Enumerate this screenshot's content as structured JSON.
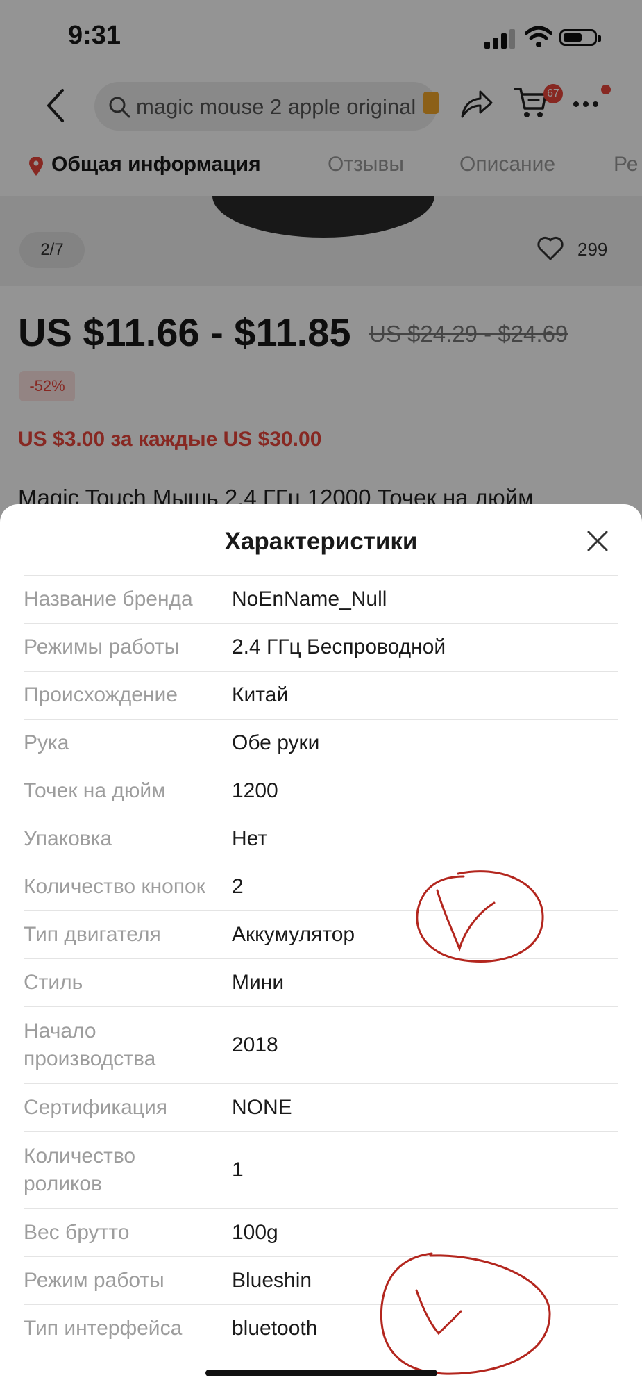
{
  "status_bar": {
    "time": "9:31"
  },
  "search": {
    "query": "magic mouse 2 apple original"
  },
  "cart": {
    "badge": "67"
  },
  "tabs": [
    {
      "label": "Общая информация"
    },
    {
      "label": "Отзывы"
    },
    {
      "label": "Описание"
    },
    {
      "label": "Ре"
    }
  ],
  "gallery": {
    "counter": "2/7",
    "favorites": "299"
  },
  "product": {
    "price": "US $11.66 - $11.85",
    "old_price": "US $24.29 - $24.69",
    "discount": "-52%",
    "promo": "US $3.00 за каждые US $30.00",
    "title": "Magic Touch Мышь 2.4 ГГц 12000 Точек на дюйм"
  },
  "sheet": {
    "title": "Характеристики",
    "rows": [
      {
        "key": "Название бренда",
        "value": "NoEnName_Null"
      },
      {
        "key": "Режимы работы",
        "value": "2.4 ГГц Беспроводной"
      },
      {
        "key": "Происхождение",
        "value": "Китай"
      },
      {
        "key": "Рука",
        "value": "Обе руки"
      },
      {
        "key": "Точек на дюйм",
        "value": "1200"
      },
      {
        "key": "Упаковка",
        "value": "Нет"
      },
      {
        "key": "Количество кнопок",
        "value": "2"
      },
      {
        "key": "Тип двигателя",
        "value": "Аккумулятор"
      },
      {
        "key": "Стиль",
        "value": "Мини"
      },
      {
        "key": "Начало производства",
        "value": "2018"
      },
      {
        "key": "Сертификация",
        "value": "NONE"
      },
      {
        "key": "Количество роликов",
        "value": "1"
      },
      {
        "key": "Вес брутто",
        "value": "100g"
      },
      {
        "key": "Режим работы",
        "value": "Blueshin"
      },
      {
        "key": "Тип интерфейса",
        "value": "bluetooth"
      }
    ]
  },
  "colors": {
    "accent": "#e8453c",
    "annotation": "#b3261e"
  }
}
